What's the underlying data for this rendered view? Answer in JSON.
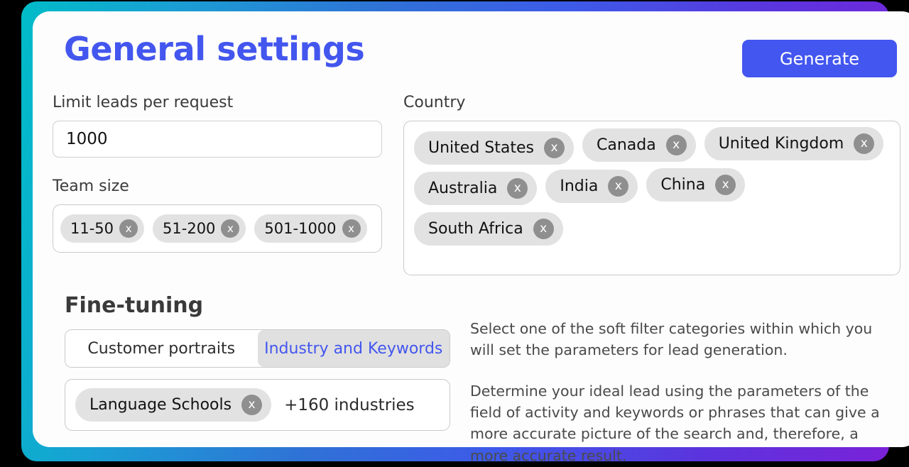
{
  "header": {
    "title": "General settings",
    "generate_label": "Generate"
  },
  "limit": {
    "label": "Limit leads per request",
    "value": "1000",
    "placeholder": "1000"
  },
  "team_size": {
    "label": "Team size",
    "chips": [
      "11-50",
      "51-200",
      "501-1000"
    ]
  },
  "country": {
    "label": "Country",
    "rows": [
      [
        "United States",
        "Canada",
        "United Kingdom"
      ],
      [
        "Australia",
        "India",
        "China"
      ],
      [
        "South Africa"
      ]
    ]
  },
  "fine_tuning": {
    "title": "Fine-tuning",
    "tabs": [
      {
        "label": "Customer portraits",
        "active": false
      },
      {
        "label": "Industry and Keywords",
        "active": true
      }
    ],
    "industry_chip": "Language Schools",
    "industry_count": "+160 industries",
    "paragraphs": [
      "Select one of the soft filter categories within which you will set the parameters for lead generation.",
      "Determine your ideal lead using the parameters of the field of activity and keywords or phrases that can give a more accurate picture of the search and, therefore, a more accurate result."
    ]
  },
  "icons": {
    "remove": "x"
  },
  "colors": {
    "accent": "#4356ee",
    "button": "#4356f0",
    "chip_bg": "#e2e2e2",
    "chip_x_bg": "#8f8f8f",
    "tab_active_bg": "#e0e0e0",
    "label": "#3a3a3a",
    "gradient_start": "#00bcc8",
    "gradient_mid": "#3d5ae8",
    "gradient_end": "#7a22d8"
  }
}
